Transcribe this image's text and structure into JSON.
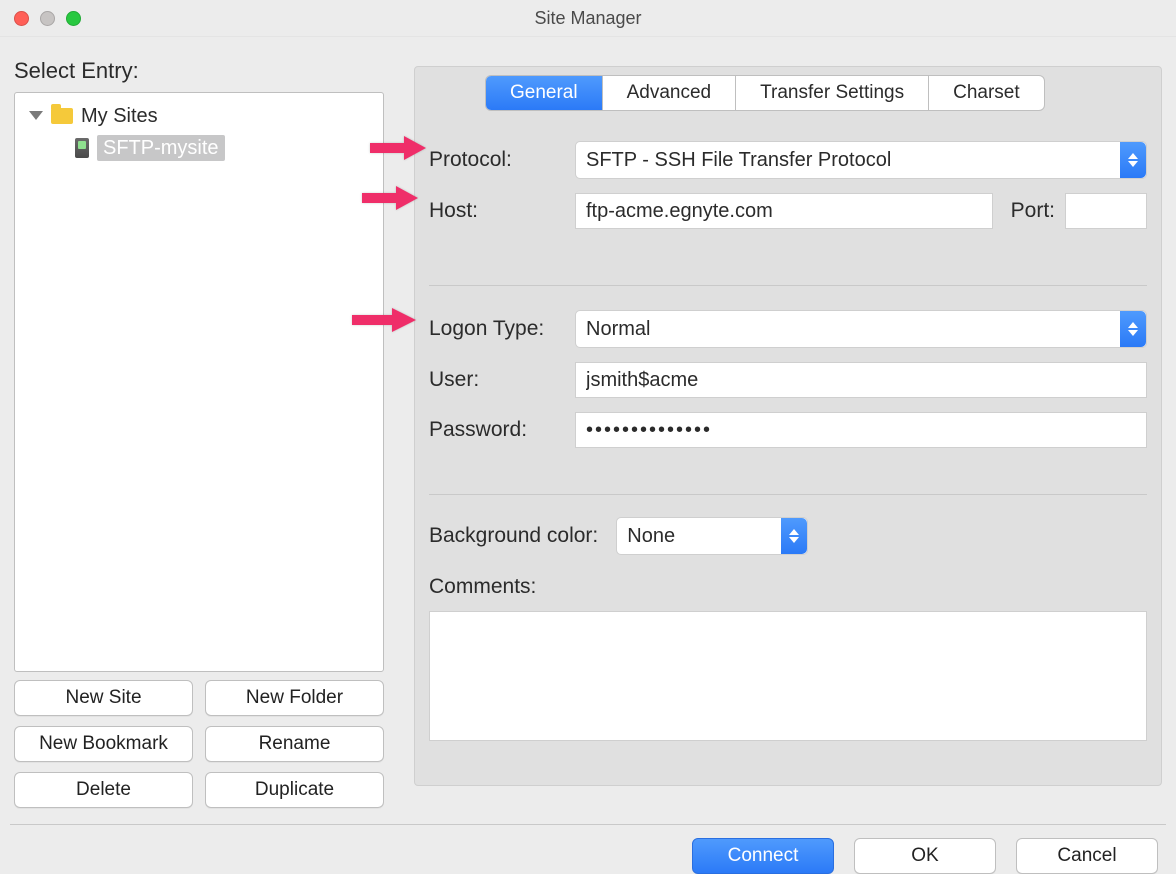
{
  "window": {
    "title": "Site Manager"
  },
  "selectEntry": {
    "label": "Select Entry:",
    "root": "My Sites",
    "site": "SFTP-mysite"
  },
  "leftButtons": {
    "newSite": "New Site",
    "newFolder": "New Folder",
    "newBookmark": "New Bookmark",
    "rename": "Rename",
    "delete": "Delete",
    "duplicate": "Duplicate"
  },
  "tabs": {
    "general": "General",
    "advanced": "Advanced",
    "transfer": "Transfer Settings",
    "charset": "Charset"
  },
  "form": {
    "protocolLabel": "Protocol:",
    "protocolValue": "SFTP - SSH File Transfer Protocol",
    "hostLabel": "Host:",
    "hostValue": "ftp-acme.egnyte.com",
    "portLabel": "Port:",
    "portValue": "",
    "logonTypeLabel": "Logon Type:",
    "logonTypeValue": "Normal",
    "userLabel": "User:",
    "userValue": "jsmith$acme",
    "passwordLabel": "Password:",
    "passwordValue": "••••••••••••••",
    "bgColorLabel": "Background color:",
    "bgColorValue": "None",
    "commentsLabel": "Comments:",
    "commentsValue": ""
  },
  "footer": {
    "connect": "Connect",
    "ok": "OK",
    "cancel": "Cancel"
  }
}
